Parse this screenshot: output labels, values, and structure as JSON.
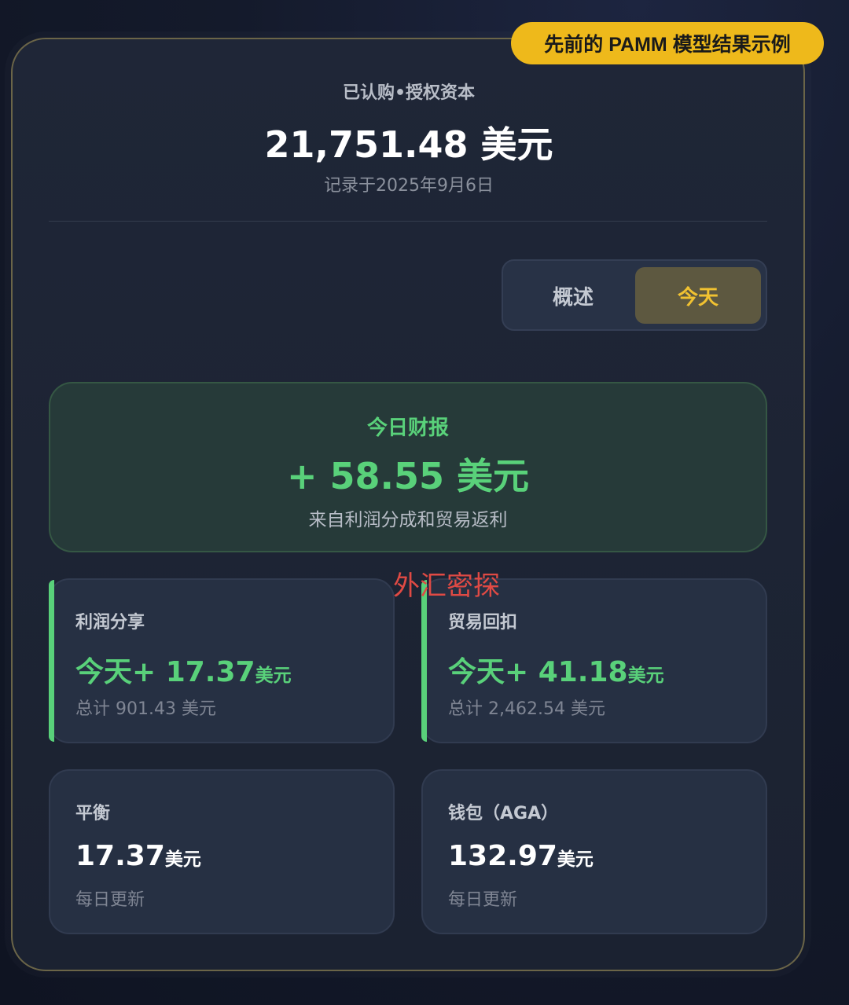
{
  "badge": {
    "text": "先前的 PAMM 模型结果示例"
  },
  "capital": {
    "label": "已认购•授权资本",
    "amount": "21,751.48 美元",
    "recorded": "记录于2025年9月6日"
  },
  "toggle": {
    "overview_label": "概述",
    "today_label": "今天",
    "active": "today"
  },
  "report": {
    "title": "今日财报",
    "amount": "+ 58.55 美元",
    "subtitle": "来自利润分成和贸易返利"
  },
  "watermark": "外汇密探",
  "stats": [
    {
      "label": "利润分享",
      "value": "今天+ 17.37",
      "unit": "美元",
      "sub": "总计 901.43 美元"
    },
    {
      "label": "贸易回扣",
      "value": "今天+ 41.18",
      "unit": "美元",
      "sub": "总计 2,462.54 美元"
    },
    {
      "label": "平衡",
      "value": "17.37",
      "unit": "美元",
      "sub": "每日更新"
    },
    {
      "label": "钱包（AGA）",
      "value": "132.97",
      "unit": "美元",
      "sub": "每日更新"
    }
  ],
  "colors": {
    "accent_gold": "#eeb91b",
    "positive_green": "#59d17a",
    "watermark_red": "#e04a44"
  }
}
